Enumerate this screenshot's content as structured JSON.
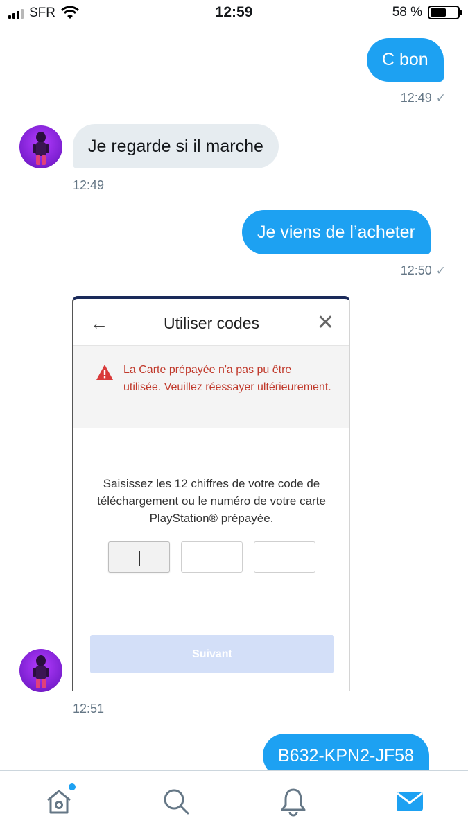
{
  "status_bar": {
    "carrier": "SFR",
    "time": "12:59",
    "battery_percent": "58 %",
    "battery_level": 0.58
  },
  "messages": [
    {
      "direction": "out",
      "text": "C bon",
      "time": "12:49"
    },
    {
      "direction": "in",
      "text": "Je regarde si il marche",
      "time": "12:49"
    },
    {
      "direction": "out",
      "text": "Je viens de l’acheter",
      "time": "12:50"
    },
    {
      "direction": "in",
      "type": "image",
      "time": "12:51"
    },
    {
      "direction": "out",
      "text": "B632-KPN2-JF58"
    }
  ],
  "check_glyph": "✓",
  "embedded_screenshot": {
    "back_glyph": "←",
    "title": "Utiliser codes",
    "close_glyph": "✕",
    "error": "La Carte prépayée n'a pas pu être utilisée. Veuillez réessayer ultérieurement.",
    "instructions": "Saisissez les 12 chiffres de votre code de téléchargement ou le numéro de votre carte PlayStation® prépayée.",
    "next_button": "Suivant"
  },
  "tabs": [
    "home-icon",
    "search-icon",
    "notifications-icon",
    "messages-icon"
  ],
  "colors": {
    "accent": "#1da1f2",
    "incoming_bubble": "#e6ecf0",
    "error": "#c0392b",
    "disabled_button": "#d3dff8"
  }
}
